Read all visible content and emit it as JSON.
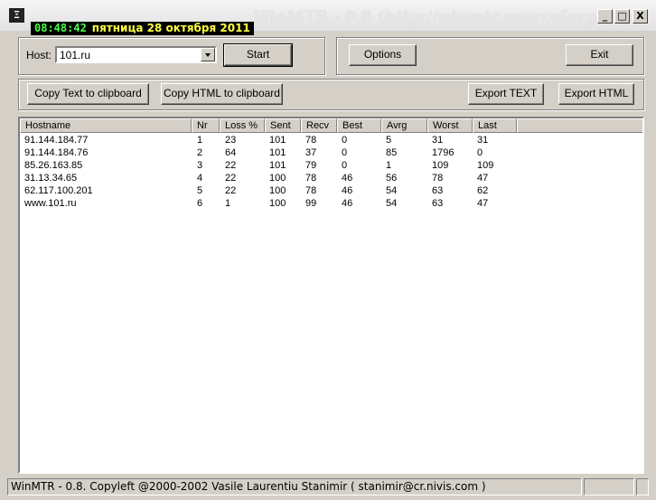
{
  "window": {
    "title": "WinMTR - 0.8 (http://winmtr.sourceforge.net)",
    "icon_glyph": "Ξ"
  },
  "clock": {
    "time": "08:48:42",
    "date": "пятница 28 октября 2011"
  },
  "titlebar_buttons": {
    "minimize": "_",
    "maximize": "□",
    "close": "X"
  },
  "host": {
    "label": "Host:",
    "value": "101.ru"
  },
  "buttons": {
    "start": "Start",
    "options": "Options",
    "exit": "Exit",
    "copy_text": "Copy Text to clipboard",
    "copy_html": "Copy HTML to clipboard",
    "export_text": "Export TEXT",
    "export_html": "Export HTML"
  },
  "table": {
    "columns": [
      "Hostname",
      "Nr",
      "Loss %",
      "Sent",
      "Recv",
      "Best",
      "Avrg",
      "Worst",
      "Last"
    ],
    "rows": [
      [
        "91.144.184.77",
        "1",
        "23",
        "101",
        "78",
        "0",
        "5",
        "31",
        "31"
      ],
      [
        "91.144.184.76",
        "2",
        "64",
        "101",
        "37",
        "0",
        "85",
        "1796",
        "0"
      ],
      [
        "85.26.163.85",
        "3",
        "22",
        "101",
        "79",
        "0",
        "1",
        "109",
        "109"
      ],
      [
        "31.13.34.65",
        "4",
        "22",
        "100",
        "78",
        "46",
        "56",
        "78",
        "47"
      ],
      [
        "62.117.100.201",
        "5",
        "22",
        "100",
        "78",
        "46",
        "54",
        "63",
        "62"
      ],
      [
        "www.101.ru",
        "6",
        "1",
        "100",
        "99",
        "46",
        "54",
        "63",
        "47"
      ]
    ]
  },
  "status": {
    "text": "WinMTR - 0.8. Copyleft @2000-2002 Vasile Laurentiu Stanimir  ( stanimir@cr.nivis.com )"
  }
}
